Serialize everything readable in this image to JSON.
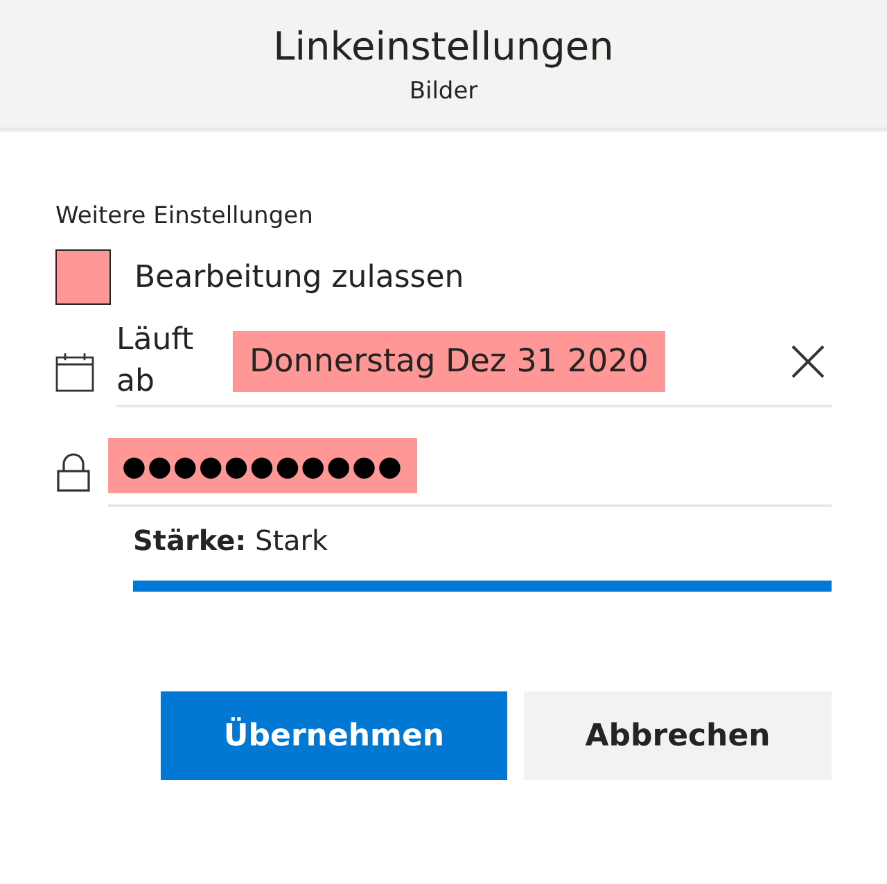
{
  "header": {
    "title": "Linkeinstellungen",
    "subtitle": "Bilder"
  },
  "section_label": "Weitere Einstellungen",
  "allow_editing": {
    "label": "Bearbeitung zulassen",
    "checked": false,
    "highlighted": true
  },
  "expiry": {
    "label": "Läuft ab",
    "value": "Donnerstag Dez 31 2020",
    "highlighted": true
  },
  "password": {
    "value": "●●●●●●●●●●●",
    "highlighted": true
  },
  "strength": {
    "text": "**Stärke:** Stark"
  },
  "buttons": [
    {
      "label": "Übernehmen",
      "kind": "primary"
    },
    {
      "label": "Abbrechen",
      "kind": "secondary"
    }
  ]
}
